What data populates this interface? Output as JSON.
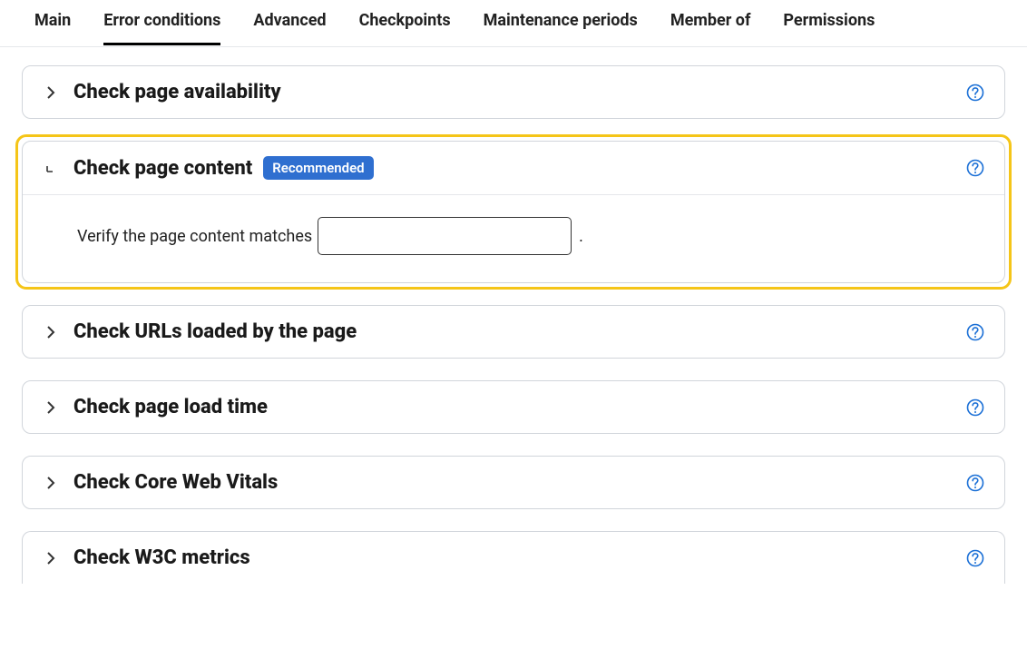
{
  "tabs": {
    "items": [
      {
        "label": "Main"
      },
      {
        "label": "Error conditions"
      },
      {
        "label": "Advanced"
      },
      {
        "label": "Checkpoints"
      },
      {
        "label": "Maintenance periods"
      },
      {
        "label": "Member of"
      },
      {
        "label": "Permissions"
      }
    ],
    "active_index": 1
  },
  "panels": {
    "availability": {
      "title": "Check page availability"
    },
    "content": {
      "title": "Check page content",
      "badge": "Recommended",
      "body_prefix": "Verify the page content matches",
      "input_value": "",
      "body_suffix": "."
    },
    "urls": {
      "title": "Check URLs loaded by the page"
    },
    "load_time": {
      "title": "Check page load time"
    },
    "cwv": {
      "title": "Check Core Web Vitals"
    },
    "w3c": {
      "title": "Check W3C metrics"
    }
  }
}
